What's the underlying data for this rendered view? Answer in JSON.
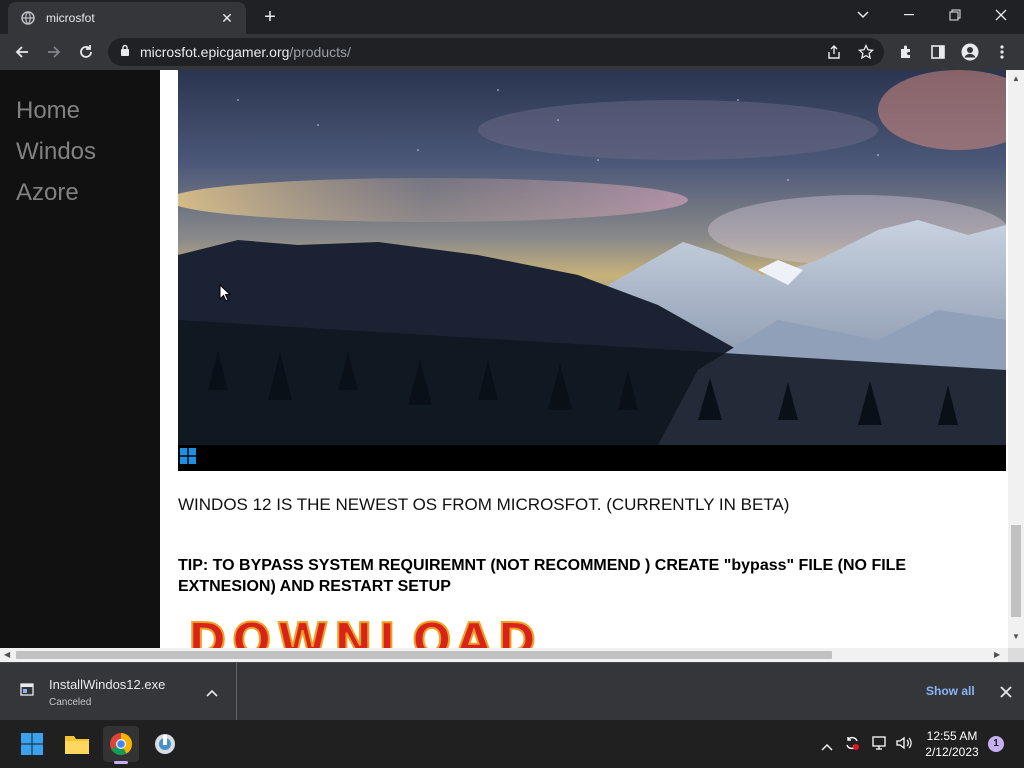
{
  "browser": {
    "tab_title": "microsfot",
    "url_host": "microsfot.epicgamer.org",
    "url_path": "/products/"
  },
  "sidebar": {
    "items": [
      {
        "label": "Home"
      },
      {
        "label": "Windos"
      },
      {
        "label": "Azore"
      }
    ]
  },
  "main": {
    "tagline": "WINDOS 12 IS THE NEWEST OS FROM MICROSFOT. (CURRENTLY IN BETA)",
    "tip": "TIP: TO BYPASS SYSTEM REQUIREMNT (NOT RECOMMEND ) CREATE \"bypass\" FILE (NO FILE EXTNESION) AND RESTART SETUP",
    "download_label": "DOWNLOAD"
  },
  "download_shelf": {
    "file_name": "InstallWindos12.exe",
    "status": "Canceled",
    "show_all": "Show all"
  },
  "taskbar": {
    "time": "12:55 AM",
    "date": "2/12/2023",
    "notification_count": "1",
    "pinned": [
      "start-icon",
      "file-explorer-icon",
      "chrome-icon",
      "setup-app-icon"
    ]
  },
  "colors": {
    "sidebar_bg": "#111111",
    "nav_link": "#818181",
    "download_red": "#d8231b",
    "link_blue": "#8ab4f8"
  }
}
